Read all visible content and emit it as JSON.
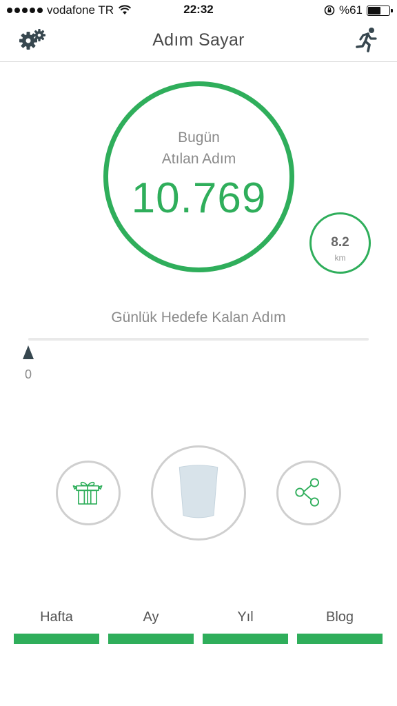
{
  "status_bar": {
    "carrier": "vodafone TR",
    "time": "22:32",
    "battery": "%61",
    "battery_level": 0.61
  },
  "header": {
    "title": "Adım Sayar",
    "settings_icon": "gear-icon",
    "activity_icon": "running-person-icon"
  },
  "today": {
    "label_line1": "Bugün",
    "label_line2": "Atılan Adım",
    "steps": "10.769"
  },
  "distance": {
    "value": "8.2",
    "unit": "km"
  },
  "goal": {
    "label": "Günlük Hedefe Kalan Adım",
    "remaining": "0",
    "progress": 0
  },
  "actions": {
    "gift_icon": "gift-icon",
    "water_icon": "water-glass-icon",
    "share_icon": "share-icon"
  },
  "tabs": [
    {
      "label": "Hafta"
    },
    {
      "label": "Ay"
    },
    {
      "label": "Yıl"
    },
    {
      "label": "Blog"
    }
  ],
  "colors": {
    "accent": "#2fae5b",
    "marker": "#37474f",
    "button_border": "#cfcfcf",
    "glass": "#d8e3ea"
  }
}
